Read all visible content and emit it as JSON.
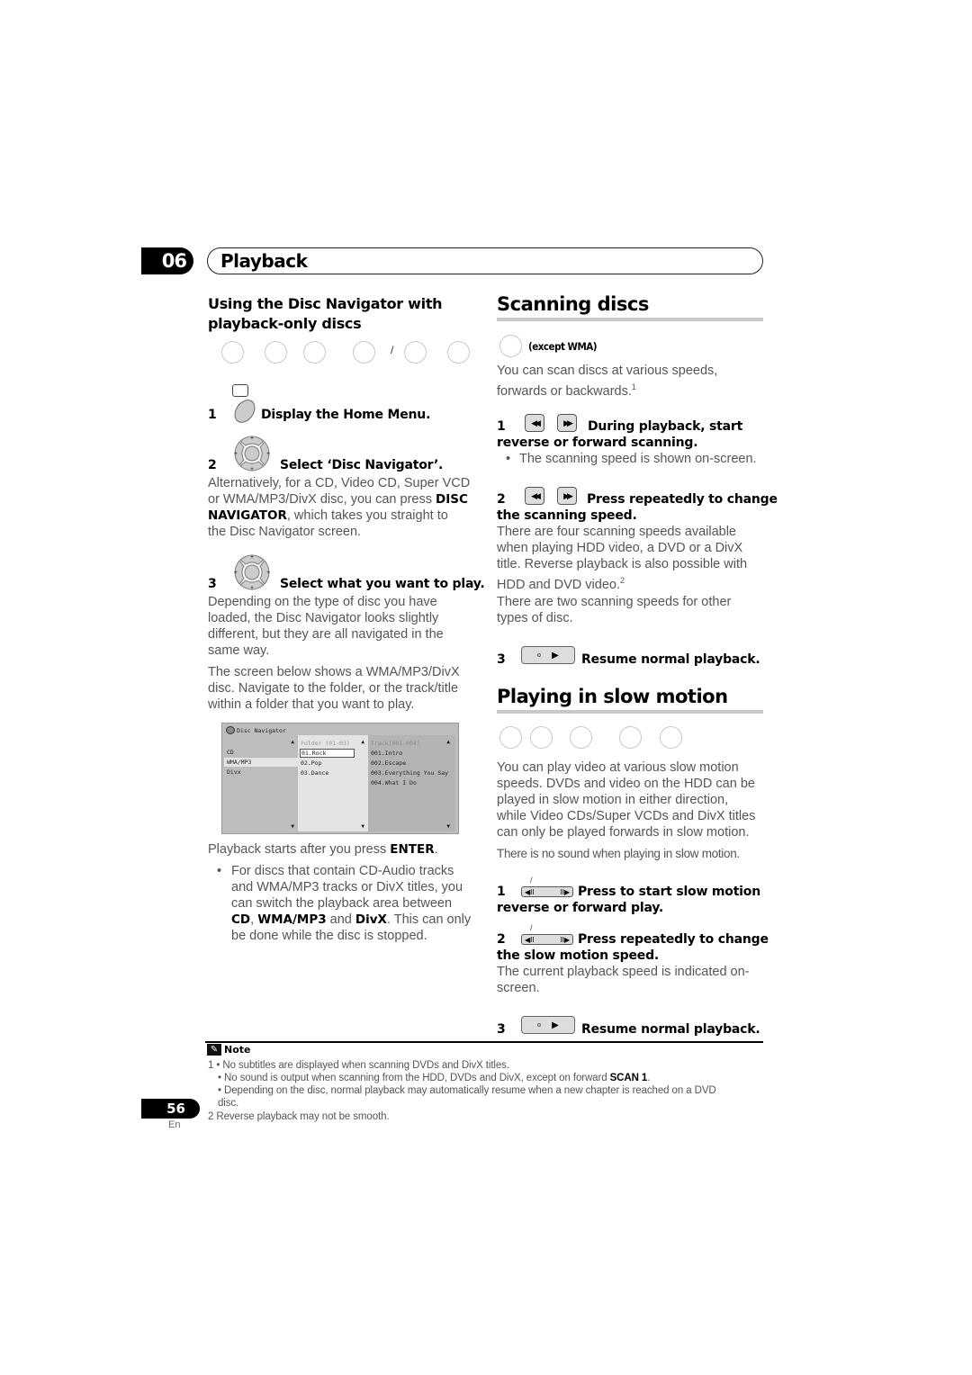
{
  "chapter": {
    "number": "06",
    "title": "Playback"
  },
  "left": {
    "heading_line1": "Using the Disc Navigator with",
    "heading_line2": "playback-only discs",
    "disc_circle_separator": "/",
    "step1": {
      "num": "1",
      "label": "Display the Home Menu."
    },
    "step2": {
      "num": "2",
      "label": "Select ‘Disc Navigator’."
    },
    "step2_body": {
      "t1": "Alternatively, for a CD, Video CD, Super VCD",
      "t2": "or WMA/MP3/DivX disc, you can press ",
      "b1": "DISC",
      "b2": "NAVIGATOR",
      "t3": ", which takes you straight to",
      "t4": "the Disc Navigator screen."
    },
    "step3": {
      "num": "3",
      "label": "Select what you want to play."
    },
    "step3_body1": [
      "Depending on the type of disc you have",
      "loaded, the Disc Navigator looks slightly",
      "different, but they are all navigated in the",
      "same way."
    ],
    "step3_body2": [
      "The screen below shows a WMA/MP3/DivX",
      "disc. Navigate to the folder, or the track/title",
      "within a folder that you want to play."
    ],
    "after_screen": {
      "text": "Playback starts after you press ",
      "bold": "ENTER",
      "end": "."
    },
    "bullet": {
      "l1": "For discs that contain CD-Audio tracks",
      "l2": "and WMA/MP3 tracks or DivX titles, you",
      "l3": "can switch the playback area between",
      "b1": "CD",
      "sep1": ", ",
      "b2": "WMA/MP3",
      "sep2": " and ",
      "b3": "DivX",
      "l4end": ". This can only",
      "l5": "be done while the disc is stopped."
    }
  },
  "disc_navigator": {
    "title": "Disc Navigator",
    "categories": [
      "CD",
      "WMA/MP3",
      "Divx"
    ],
    "selected_category": "WMA/MP3",
    "folder_header": "Folder (01-03)",
    "folders": [
      "01.Rock",
      "02.Pop",
      "03.Dance"
    ],
    "selected_folder": "01.Rock",
    "track_header": "Track(001-004)",
    "tracks": [
      "001.Intro",
      "002.Escape",
      "003.Everything You Say",
      "004.What I Do"
    ],
    "up_arrow": "▲",
    "down_arrow": "▼"
  },
  "scanning": {
    "heading": "Scanning discs",
    "except": "(except WMA)",
    "intro": [
      "You can scan discs at various speeds,",
      "forwards or backwards."
    ],
    "intro_sup": "1",
    "step1": {
      "num": "1",
      "label1": "During playback, start",
      "label2": "reverse or forward scanning."
    },
    "step1_bullet": "The scanning speed is shown on-screen.",
    "step2": {
      "num": "2",
      "label1": "Press repeatedly to change",
      "label2": "the scanning speed."
    },
    "step2_body1": [
      "There are four scanning speeds available",
      "when playing HDD video, a DVD or a DivX",
      "title. Reverse playback is also possible with",
      "HDD and DVD video."
    ],
    "step2_sup": "2",
    "step2_body2": [
      "There are two scanning speeds for other",
      "types of disc."
    ],
    "step3": {
      "num": "3",
      "label": "Resume normal playback."
    },
    "rev_key": "◀◀",
    "fwd_key": "▶▶",
    "play_key": "▶"
  },
  "slow": {
    "heading": "Playing in slow motion",
    "body": [
      "You can play video at various slow motion",
      "speeds. DVDs and video on the HDD can be",
      "played in slow motion in either direction,",
      "while Video CDs/Super VCDs and DivX titles",
      "can only be played forwards in slow motion."
    ],
    "nosound": "There is no sound when playing in slow motion.",
    "step1": {
      "num": "1",
      "label1": "Press to start slow motion",
      "label2": "reverse or forward play."
    },
    "step2": {
      "num": "2",
      "label1": "Press repeatedly to change",
      "label2": "the slow motion speed."
    },
    "step2_body": [
      "The current playback speed is indicated on-",
      "screen."
    ],
    "step3": {
      "num": "3",
      "label": "Resume normal playback."
    },
    "slow_rev": "◀II",
    "slow_fwd": "II▶",
    "slash": "/"
  },
  "note": {
    "label": "Note",
    "n1a": "1 • No subtitles are displayed when scanning DVDs and DivX titles.",
    "n1b": "• No sound is output when scanning from the HDD, DVDs and DivX, except on forward ",
    "n1b_bold": "SCAN 1",
    "n1b_end": ".",
    "n1c": "• Depending on the disc, normal playback may automatically resume when a new chapter is reached on a DVD",
    "n1d": "disc.",
    "n2": "2 Reverse playback may not be smooth."
  },
  "footer": {
    "page": "56",
    "lang": "En"
  }
}
